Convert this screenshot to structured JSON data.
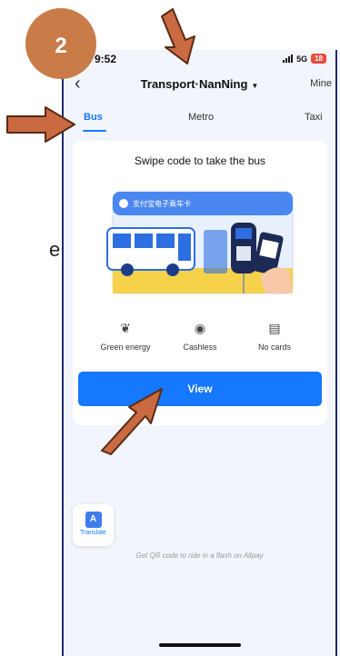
{
  "status_bar": {
    "time": "9:52",
    "signal": "5G",
    "battery": "18"
  },
  "nav": {
    "back_icon": "chevron-left-icon",
    "title": "Transport·NanNing",
    "mine": "Mine"
  },
  "tabs": [
    {
      "label": "Bus",
      "active": true
    },
    {
      "label": "Metro",
      "active": false
    },
    {
      "label": "Taxi",
      "active": false
    }
  ],
  "card": {
    "title": "Swipe code to take the bus",
    "illustration_text": "支付宝电子乘车卡",
    "features": [
      {
        "icon": "leaf-icon",
        "label": "Green energy"
      },
      {
        "icon": "coin-icon",
        "label": "Cashless"
      },
      {
        "icon": "card-icon",
        "label": "No cards"
      }
    ],
    "view_label": "View"
  },
  "translate_label": "Translate",
  "footer_text": "Get QR code to ride in a flash on Alipay",
  "annotation": {
    "step_number": "2",
    "step_color": "#c97b48"
  },
  "colors": {
    "accent": "#1677ff",
    "arrow": "#c96a42"
  }
}
